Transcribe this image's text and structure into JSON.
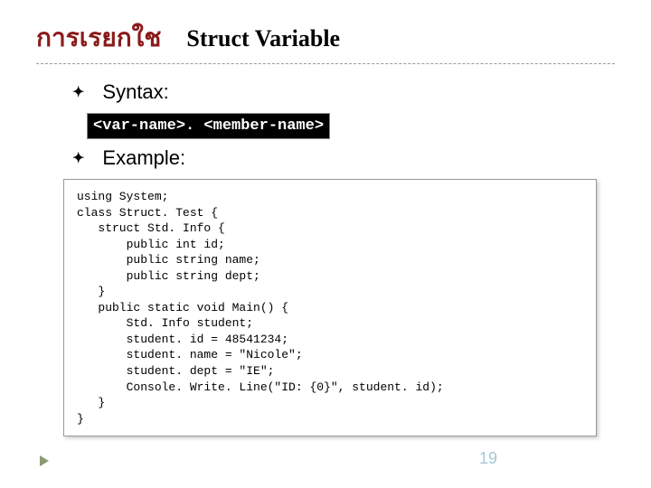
{
  "title": {
    "thai": "การเรยกใช",
    "en": "Struct Variable"
  },
  "bullets": {
    "syntax_label": "Syntax:",
    "example_label": "Example:"
  },
  "syntax_line": "<var-name>. <member-name>",
  "code": "using System;\nclass Struct. Test {\n   struct Std. Info {\n       public int id;\n       public string name;\n       public string dept;\n   }\n   public static void Main() {\n       Std. Info student;\n       student. id = 48541234;\n       student. name = \"Nicole\";\n       student. dept = \"IE\";\n       Console. Write. Line(\"ID: {0}\", student. id);\n   }\n}",
  "page_number": "19"
}
